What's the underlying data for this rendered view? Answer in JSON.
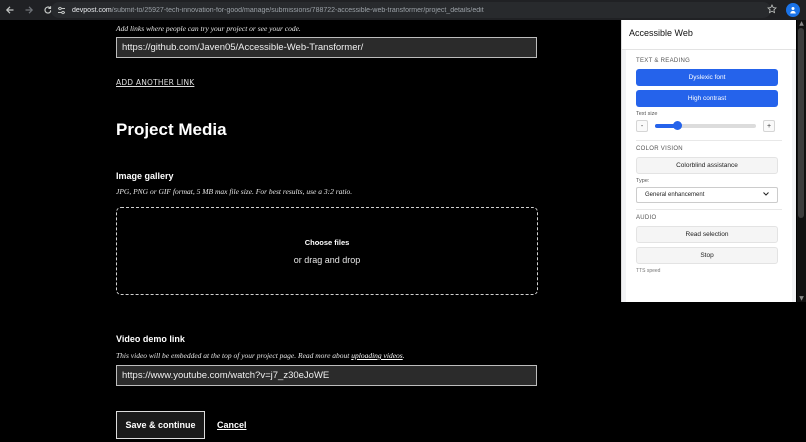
{
  "browser": {
    "url_domain": "devpost.com",
    "url_path": "/submit-to/25927-tech-innovation-for-good/manage/submissions/788722-accessible-web-transformer/project_details/edit",
    "icons": [
      "back-icon",
      "forward-icon",
      "reload-icon",
      "site-info-icon",
      "bookmark-star-icon",
      "extension-icon"
    ]
  },
  "links_section": {
    "hint": "Add links where people can try your project or see your code.",
    "link_value": "https://github.com/Javen05/Accessible-Web-Transformer/",
    "add_link_label": "ADD ANOTHER LINK"
  },
  "media": {
    "title": "Project Media",
    "gallery_label": "Image gallery",
    "gallery_hint": "JPG, PNG or GIF format, 5 MB max file size. For best results, use a 3:2 ratio.",
    "choose_files": "Choose files",
    "drag_drop": "or drag and drop",
    "video_label": "Video demo link",
    "video_hint_prefix": "This video will be embedded at the top of your project page. Read more about ",
    "video_hint_link": "uploading videos",
    "video_hint_suffix": ".",
    "video_value": "https://www.youtube.com/watch?v=j7_z30eJoWE"
  },
  "actions": {
    "save_label": "Save & continue",
    "cancel_label": "Cancel"
  },
  "panel": {
    "title": "Accessible Web",
    "text_reading": {
      "heading": "TEXT & READING",
      "dyslexic_label": "Dyslexic font",
      "contrast_label": "High contrast",
      "text_size_label": "Text size",
      "minus": "-",
      "plus": "+",
      "text_size_level": 0.22
    },
    "color_vision": {
      "heading": "COLOR VISION",
      "assist_label": "Colorblind assistance",
      "type_label": "Type:",
      "type_value": "General enhancement"
    },
    "audio": {
      "heading": "AUDIO",
      "read_label": "Read selection",
      "stop_label": "Stop",
      "cut_label": "TTS speed"
    },
    "colors": {
      "accent": "#2563eb"
    }
  }
}
